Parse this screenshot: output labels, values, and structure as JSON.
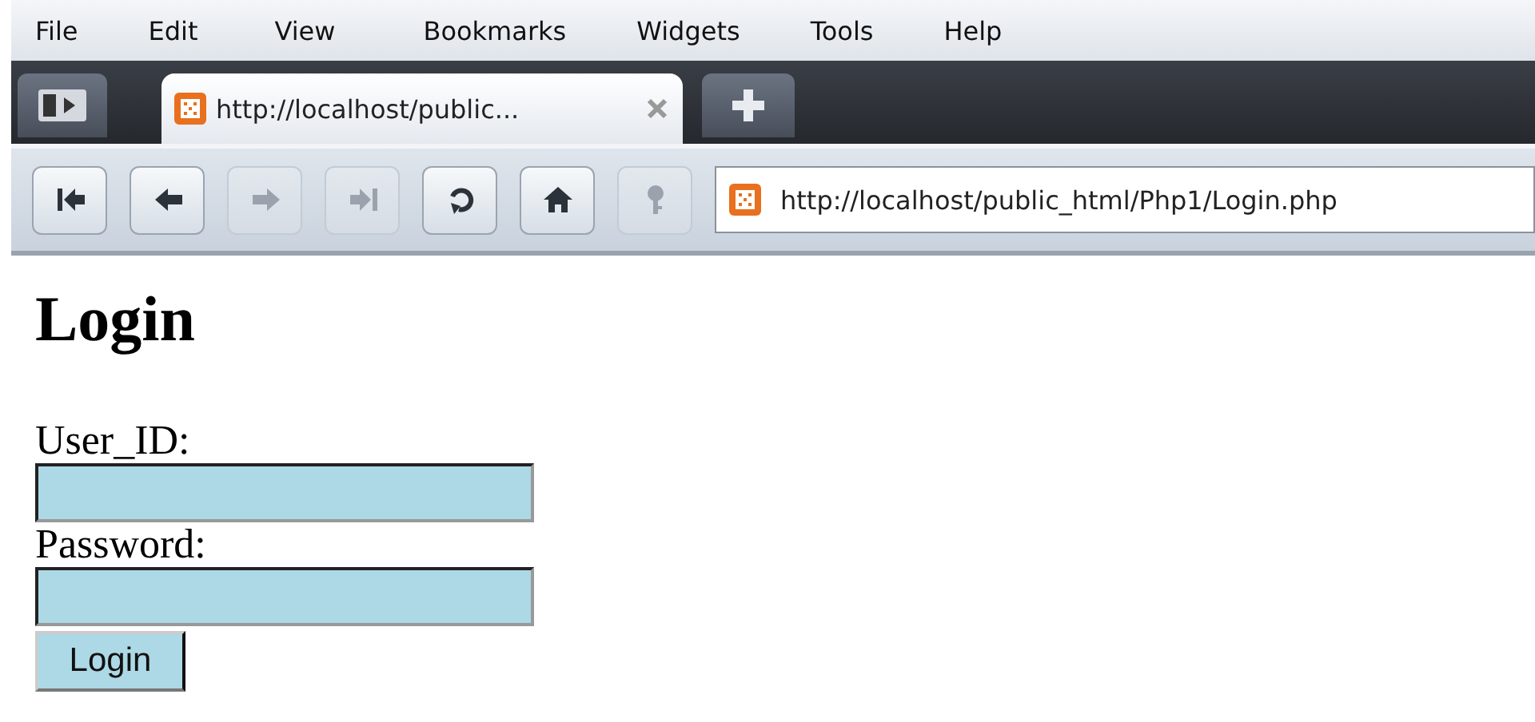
{
  "menu": [
    "File",
    "Edit",
    "View",
    "Bookmarks",
    "Widgets",
    "Tools",
    "Help"
  ],
  "tabs": [
    {
      "title": "http://localhost/public...",
      "selected": true
    }
  ],
  "toolbar": [
    {
      "kind": "rewind",
      "disabled": false
    },
    {
      "kind": "back",
      "disabled": false
    },
    {
      "kind": "forward",
      "disabled": true
    },
    {
      "kind": "fastforward",
      "disabled": true
    },
    {
      "kind": "reload",
      "disabled": false
    },
    {
      "kind": "home",
      "disabled": false
    },
    {
      "kind": "key",
      "disabled": true
    }
  ],
  "address": "http://localhost/public_html/Php1/Login.php",
  "page": {
    "heading": "Login",
    "fields": [
      {
        "label": "User_ID:"
      },
      {
        "label": "Password:"
      }
    ],
    "button": "Login"
  }
}
